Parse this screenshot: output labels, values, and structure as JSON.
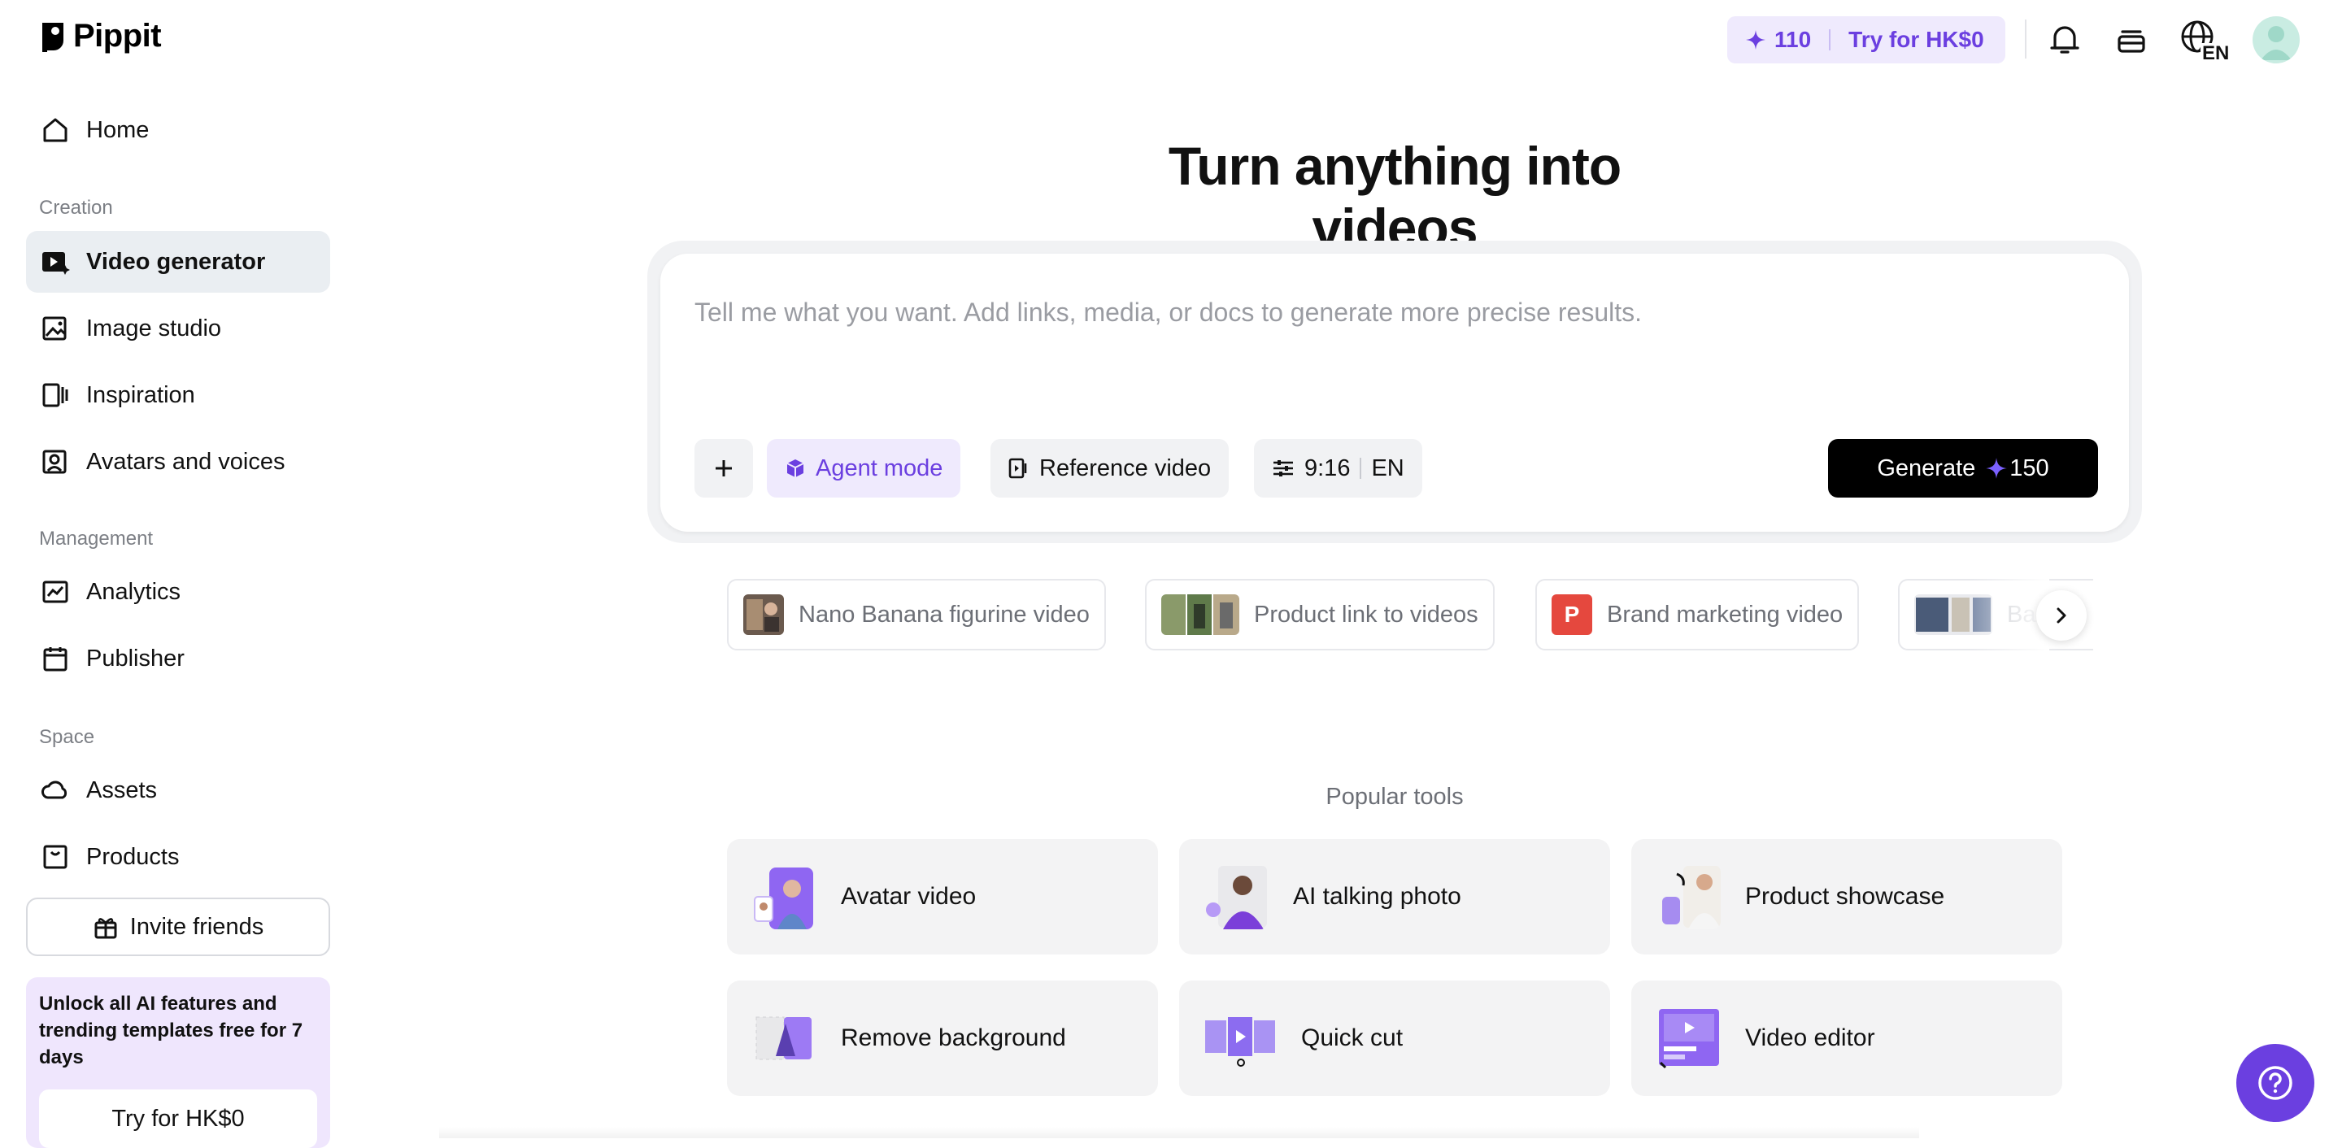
{
  "brand": {
    "name": "Pippit"
  },
  "sidebar": {
    "home": "Home",
    "sections": {
      "creation": "Creation",
      "management": "Management",
      "space": "Space"
    },
    "items": [
      {
        "label": "Video generator",
        "icon": "video-sparkle-icon",
        "active": true
      },
      {
        "label": "Image studio",
        "icon": "image-sparkle-icon"
      },
      {
        "label": "Inspiration",
        "icon": "inspiration-icon"
      },
      {
        "label": "Avatars and voices",
        "icon": "avatar-icon"
      },
      {
        "label": "Analytics",
        "icon": "analytics-icon"
      },
      {
        "label": "Publisher",
        "icon": "calendar-icon"
      },
      {
        "label": "Assets",
        "icon": "cloud-icon"
      },
      {
        "label": "Products",
        "icon": "product-icon"
      }
    ],
    "invite": "Invite friends",
    "promo": {
      "text": "Unlock all AI features and trending templates free for 7 days",
      "button": "Try for HK$0"
    }
  },
  "topbar": {
    "credits": "110",
    "trial": "Try for HK$0",
    "lang_badge": "EN"
  },
  "main": {
    "title": "Turn anything into videos",
    "prompt": {
      "placeholder": "Tell me what you want. Add links, media, or docs to generate more precise results.",
      "agent_mode": "Agent mode",
      "reference_video": "Reference video",
      "ratio": "9:16",
      "language": "EN",
      "generate": "Generate",
      "generate_cost": "150"
    },
    "suggestions": [
      "Nano Banana figurine video",
      "Product link to videos",
      "Brand marketing video",
      "Ba"
    ],
    "brand_badge_letter": "P",
    "popular_title": "Popular tools",
    "tools": [
      "Avatar video",
      "AI talking photo",
      "Product showcase",
      "Remove background",
      "Quick cut",
      "Video editor"
    ]
  },
  "colors": {
    "accent": "#6b3fe0",
    "active_bg": "#eaeef2",
    "promo_bg": "#efe6fd"
  }
}
